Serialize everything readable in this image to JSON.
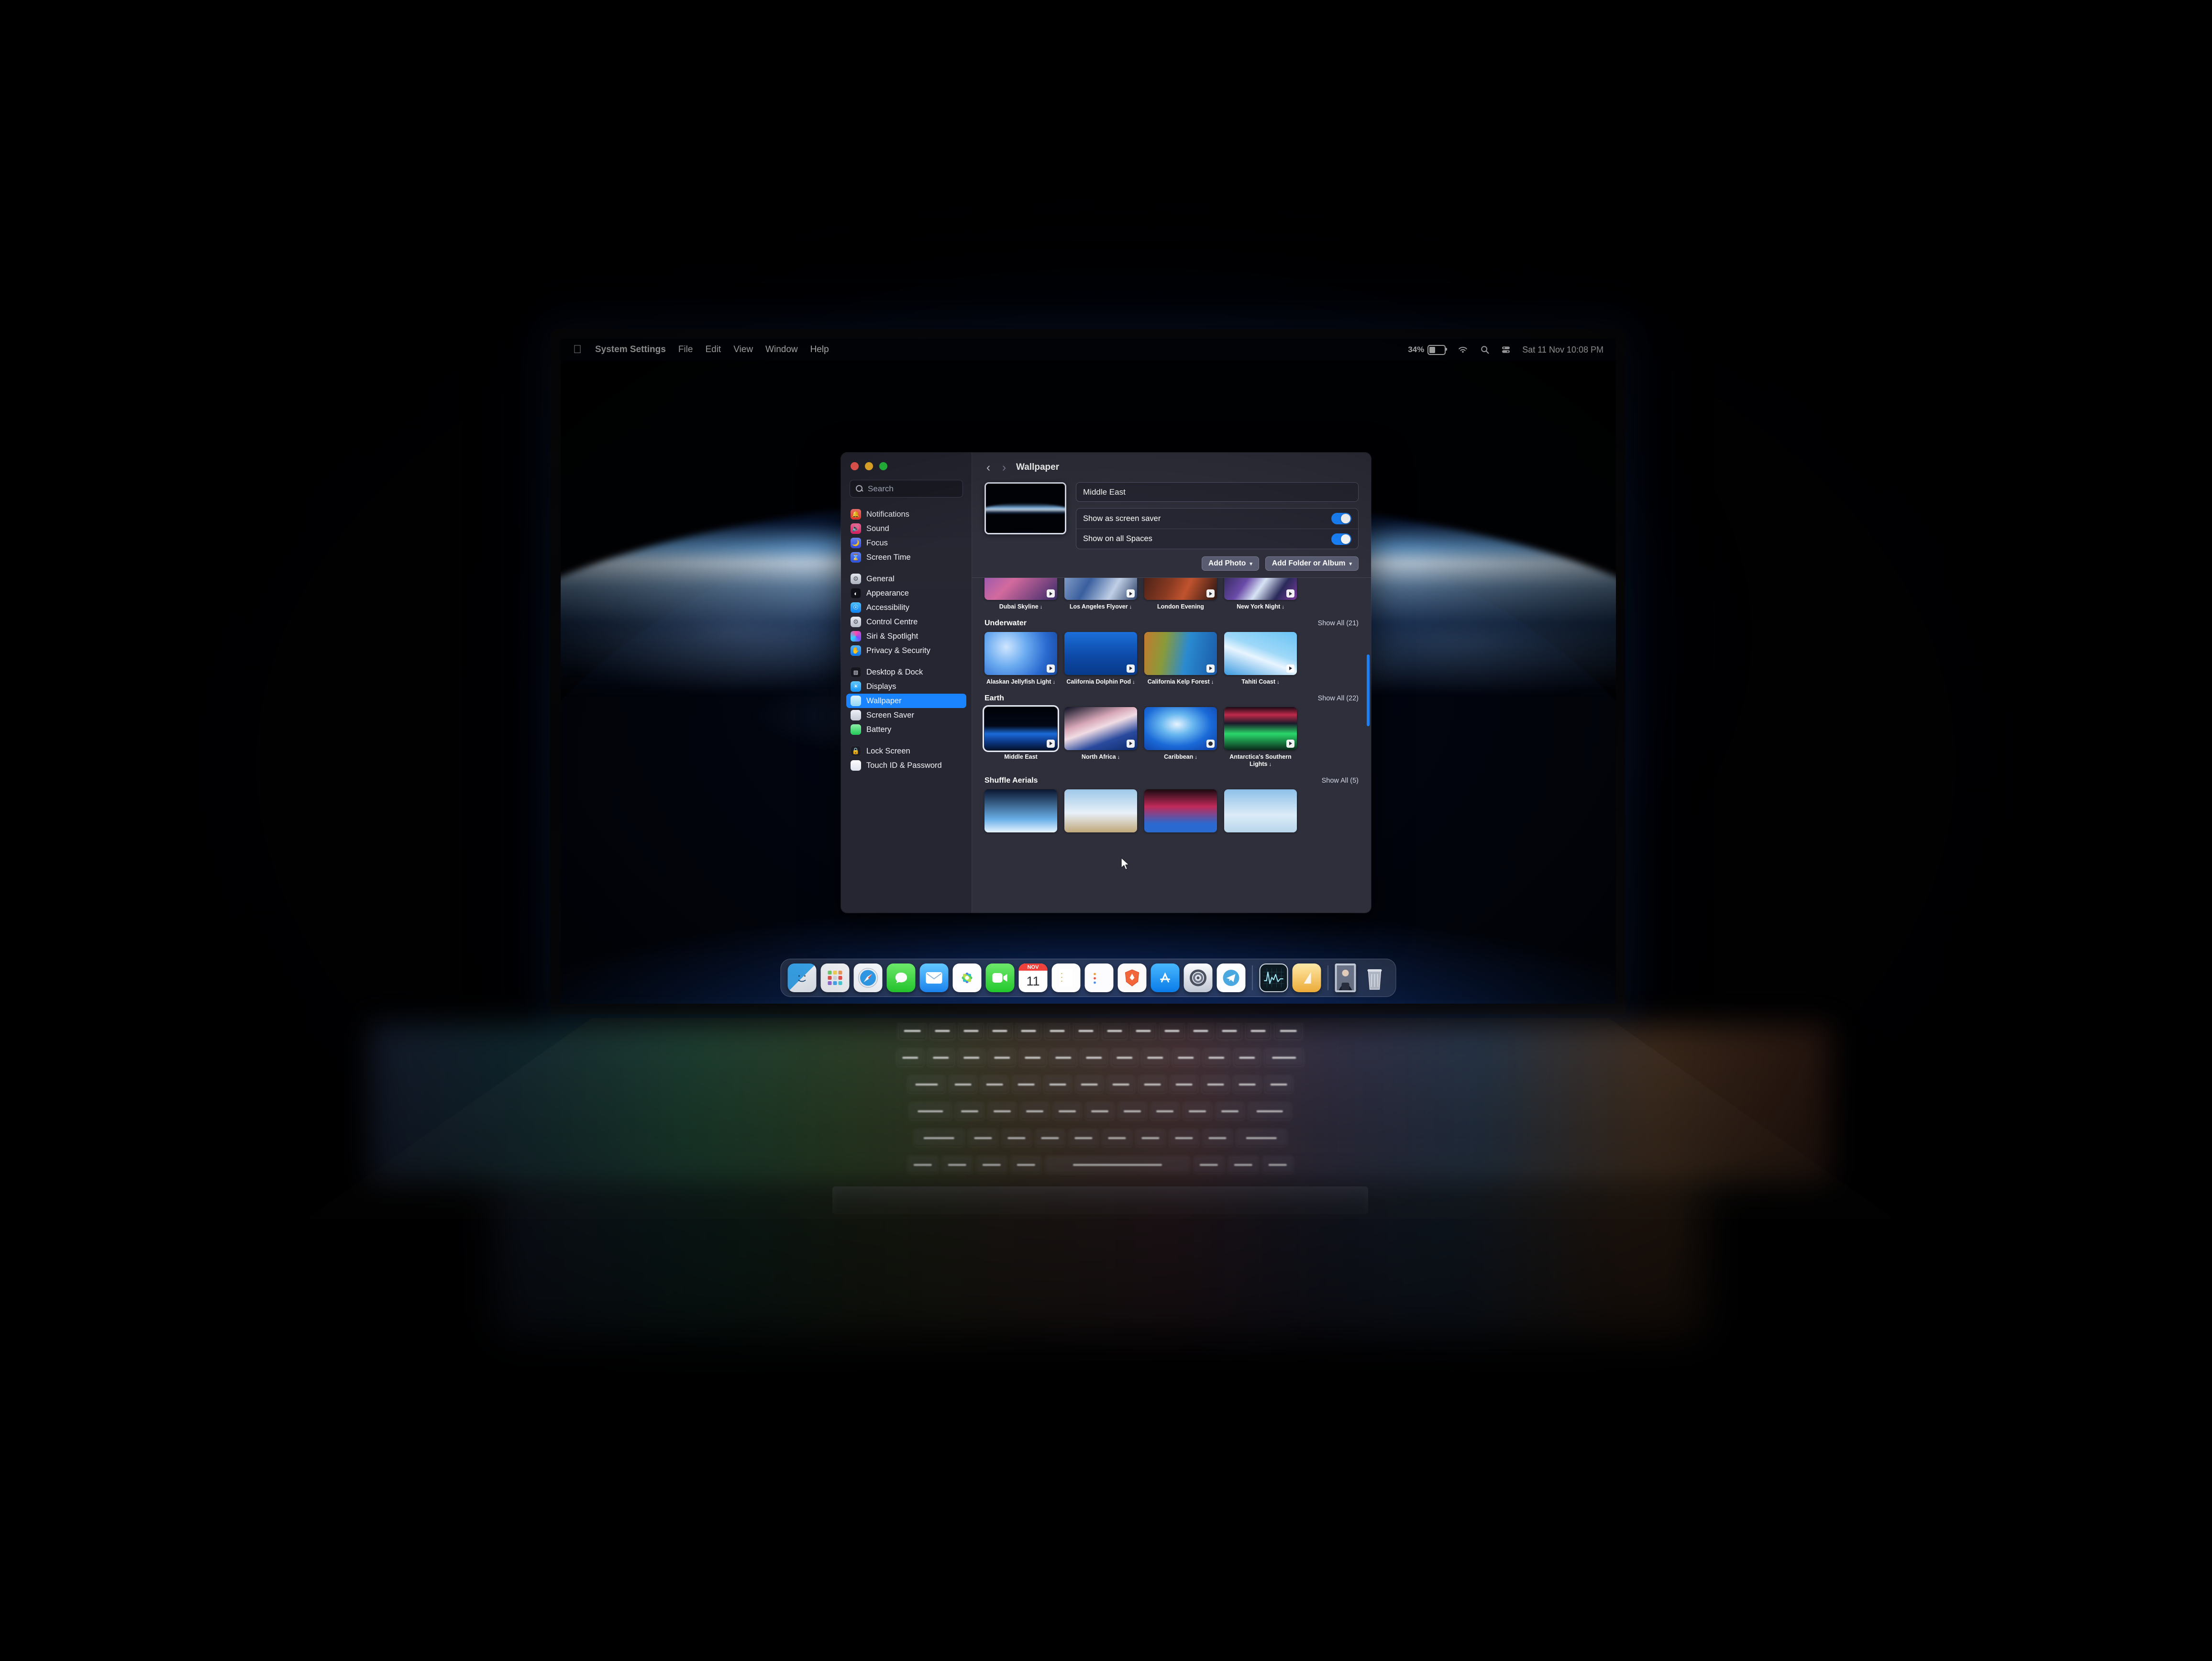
{
  "menubar": {
    "apple_icon": "apple-logo",
    "items": [
      "System Settings",
      "File",
      "Edit",
      "View",
      "Window",
      "Help"
    ],
    "status": {
      "battery_percent": "34%",
      "battery_icon": "battery-icon",
      "wifi_icon": "wifi-icon",
      "search_icon": "spotlight-search-icon",
      "control_centre_icon": "control-centre-icon",
      "datetime": "Sat 11 Nov 10:08 PM"
    }
  },
  "window": {
    "title": "Wallpaper",
    "traffic_lights": [
      "close",
      "minimize",
      "zoom"
    ],
    "back_icon": "chevron-left-icon",
    "forward_icon": "chevron-right-icon",
    "search": {
      "placeholder": "Search",
      "value": "",
      "icon": "search-icon"
    },
    "sidebar_groups": [
      {
        "items": [
          {
            "label": "Notifications",
            "icon": "bell-icon",
            "color": "#ff4a4a",
            "selected": false
          },
          {
            "label": "Sound",
            "icon": "speaker-icon",
            "color": "#f0306e",
            "selected": false
          },
          {
            "label": "Focus",
            "icon": "moon-icon",
            "color": "#4a6af0",
            "selected": false
          },
          {
            "label": "Screen Time",
            "icon": "hourglass-icon",
            "color": "#3a66e8",
            "selected": false
          }
        ]
      },
      {
        "items": [
          {
            "label": "General",
            "icon": "gear-icon",
            "color": "#b8bcc8",
            "selected": false
          },
          {
            "label": "Appearance",
            "icon": "contrast-circle-icon",
            "color": "#1a1a22",
            "selected": false
          },
          {
            "label": "Accessibility",
            "icon": "accessibility-icon",
            "color": "#1f8cf5",
            "selected": false
          },
          {
            "label": "Control Centre",
            "icon": "switches-icon",
            "color": "#c3c7d2",
            "selected": false
          },
          {
            "label": "Siri & Spotlight",
            "icon": "siri-orb-icon",
            "color": "#d23a7a",
            "selected": false
          },
          {
            "label": "Privacy & Security",
            "icon": "hand-raised-icon",
            "color": "#2f9bff",
            "selected": false
          }
        ]
      },
      {
        "items": [
          {
            "label": "Desktop & Dock",
            "icon": "desktop-dock-icon",
            "color": "#1c1c26",
            "selected": false
          },
          {
            "label": "Displays",
            "icon": "brightness-icon",
            "color": "#2fa9f7",
            "selected": false
          },
          {
            "label": "Wallpaper",
            "icon": "wallpaper-icon",
            "color": "#7fd3f5",
            "selected": true
          },
          {
            "label": "Screen Saver",
            "icon": "screen-saver-icon",
            "color": "#cfd6e6",
            "selected": false
          },
          {
            "label": "Battery",
            "icon": "battery-green-icon",
            "color": "#37d06a",
            "selected": false
          }
        ]
      },
      {
        "items": [
          {
            "label": "Lock Screen",
            "icon": "lock-icon",
            "color": "#23232e",
            "selected": false
          },
          {
            "label": "Touch ID & Password",
            "icon": "touch-id-icon",
            "color": "#f1f3f8",
            "selected": false
          }
        ]
      }
    ],
    "detail": {
      "preview_name": "Middle East",
      "name_field_value": "Middle East",
      "toggles": [
        {
          "label": "Show as screen saver",
          "on": true
        },
        {
          "label": "Show on all Spaces",
          "on": true
        }
      ],
      "buttons": [
        {
          "label": "Add Photo",
          "chevron": "chevron-down-icon"
        },
        {
          "label": "Add Folder or Album",
          "chevron": "chevron-down-icon"
        }
      ],
      "sections": [
        {
          "title": "",
          "show_all": "",
          "clipped_top": true,
          "items": [
            {
              "caption": "Dubai Skyline",
              "download": true,
              "badge": "motion"
            },
            {
              "caption": "Los Angeles Flyover",
              "download": true,
              "badge": "motion"
            },
            {
              "caption": "London Evening",
              "download": false,
              "badge": "motion"
            },
            {
              "caption": "New York Night",
              "download": true,
              "badge": "motion"
            }
          ]
        },
        {
          "title": "Underwater",
          "show_all": "Show All (21)",
          "clipped_top": false,
          "items": [
            {
              "caption": "Alaskan Jellyfish Light",
              "download": true,
              "badge": "motion"
            },
            {
              "caption": "California Dolphin Pod",
              "download": true,
              "badge": "motion"
            },
            {
              "caption": "California Kelp Forest",
              "download": true,
              "badge": "motion"
            },
            {
              "caption": "Tahiti Coast",
              "download": true,
              "badge": "motion"
            }
          ]
        },
        {
          "title": "Earth",
          "show_all": "Show All (22)",
          "clipped_top": false,
          "items": [
            {
              "caption": "Middle East",
              "download": false,
              "badge": "motion",
              "selected": true
            },
            {
              "caption": "North Africa",
              "download": true,
              "badge": "motion"
            },
            {
              "caption": "Caribbean",
              "download": true,
              "badge": "people"
            },
            {
              "caption": "Antarctica's Southern Lights",
              "download": true,
              "badge": "motion"
            }
          ]
        },
        {
          "title": "Shuffle Aerials",
          "show_all": "Show All (5)",
          "clipped_top": false,
          "items": [
            {
              "caption": "",
              "download": false,
              "badge": ""
            },
            {
              "caption": "",
              "download": false,
              "badge": ""
            },
            {
              "caption": "",
              "download": false,
              "badge": ""
            },
            {
              "caption": "",
              "download": false,
              "badge": ""
            }
          ]
        }
      ]
    }
  },
  "dock": {
    "apps": [
      {
        "name": "Finder",
        "icon": "finder-icon",
        "running": true
      },
      {
        "name": "Launchpad",
        "icon": "launchpad-icon",
        "running": false
      },
      {
        "name": "Safari",
        "icon": "safari-icon",
        "running": true
      },
      {
        "name": "Messages",
        "icon": "messages-icon",
        "running": false
      },
      {
        "name": "Mail",
        "icon": "mail-icon",
        "running": false
      },
      {
        "name": "Photos",
        "icon": "photos-icon",
        "running": false
      },
      {
        "name": "FaceTime",
        "icon": "facetime-icon",
        "running": false
      },
      {
        "name": "Calendar",
        "icon": "calendar-icon",
        "running": false,
        "month": "NOV",
        "day": "11"
      },
      {
        "name": "Notes",
        "icon": "notes-icon",
        "running": false
      },
      {
        "name": "Reminders",
        "icon": "reminders-icon",
        "running": false
      },
      {
        "name": "Brave Browser",
        "icon": "brave-icon",
        "running": false
      },
      {
        "name": "App Store",
        "icon": "app-store-icon",
        "running": false
      },
      {
        "name": "System Settings",
        "icon": "system-settings-icon",
        "running": true
      },
      {
        "name": "Telegram",
        "icon": "telegram-icon",
        "running": false
      }
    ],
    "utilities": [
      {
        "name": "Activity Monitor",
        "icon": "activity-monitor-icon"
      },
      {
        "name": "Notes Document",
        "icon": "pages-icon"
      }
    ],
    "files": [
      {
        "name": "Photo Thumbnail",
        "icon": "photo-file-icon"
      },
      {
        "name": "Trash",
        "icon": "trash-icon"
      }
    ]
  },
  "desktop": {
    "wallpaper_name": "Middle East"
  },
  "cursor": {
    "icon": "arrow-cursor-icon"
  }
}
